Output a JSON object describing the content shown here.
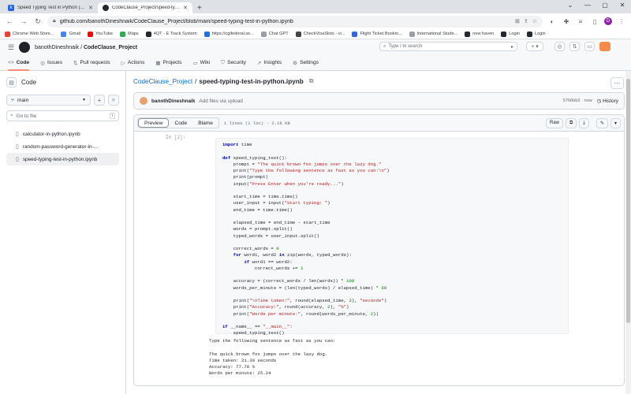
{
  "browser": {
    "tabs": [
      {
        "title": "Speed Typing Test in Python | Ka",
        "active": false,
        "icon": "k"
      },
      {
        "title": "CodeClause_Project/speed-typin",
        "active": true,
        "icon": "github"
      }
    ],
    "url": "github.com/banothDineshnaik/CodeClause_Project/blob/main/speed-typing-test-in-python.ipynb",
    "profile_initial": "D",
    "bookmarks": [
      {
        "label": "Chrome Web Store...",
        "color": "#ea4335"
      },
      {
        "label": "Gmail",
        "color": "#4285f4"
      },
      {
        "label": "YouTube",
        "color": "#ff0000"
      },
      {
        "label": "Maps",
        "color": "#34a853"
      },
      {
        "label": "4QT - E Track System",
        "color": "#24292f"
      },
      {
        "label": "https://cgifederal.se...",
        "color": "#1a73e8"
      },
      {
        "label": "Chat GPT",
        "color": "#9aa0a6"
      },
      {
        "label": "CheckVisaSlots - vi...",
        "color": "#444"
      },
      {
        "label": "Flight Ticket Bookin...",
        "color": "#3367d6"
      },
      {
        "label": "International Stude...",
        "color": "#9aa0a6"
      },
      {
        "label": "new haven",
        "color": "#24292f"
      },
      {
        "label": "Login",
        "color": "#24292f"
      },
      {
        "label": "Login",
        "color": "#24292f"
      }
    ]
  },
  "github": {
    "owner": "banothDineshnaik",
    "repo": "CodeClause_Project",
    "search_placeholder": "Type / to search",
    "nav": [
      {
        "label": "Code",
        "icon": "<>",
        "active": true
      },
      {
        "label": "Issues",
        "icon": "◎",
        "active": false
      },
      {
        "label": "Pull requests",
        "icon": "⇅",
        "active": false
      },
      {
        "label": "Actions",
        "icon": "▷",
        "active": false
      },
      {
        "label": "Projects",
        "icon": "▦",
        "active": false
      },
      {
        "label": "Wiki",
        "icon": "▭",
        "active": false
      },
      {
        "label": "Security",
        "icon": "⛉",
        "active": false
      },
      {
        "label": "Insights",
        "icon": "↗",
        "active": false
      },
      {
        "label": "Settings",
        "icon": "⚙",
        "active": false
      }
    ]
  },
  "sidebar": {
    "title": "Code",
    "branch": "main",
    "goto_placeholder": "Go to file",
    "goto_shortcut": "t",
    "files": [
      {
        "name": "calculator-in-python.ipynb",
        "selected": false
      },
      {
        "name": "random-password-generator-in-...",
        "selected": false
      },
      {
        "name": "speed-typing-test-in-python.ipynb",
        "selected": true
      }
    ]
  },
  "file": {
    "repo_link": "CodeClause_Project",
    "separator": "/",
    "name": "speed-typing-test-in-python.ipynb",
    "commit_author": "banothDineshnaik",
    "commit_message": "Add files via upload",
    "commit_meta": "5766bb2 · now",
    "history_label": "History",
    "tabs": [
      "Preview",
      "Code",
      "Blame"
    ],
    "active_tab": "Preview",
    "meta": "1 lines (1 loc) · 2.18 KB",
    "raw_label": "Raw"
  },
  "notebook": {
    "prompt": "In [2]:",
    "output_lines": [
      "Type the following sentence as fast as you can:",
      "",
      "The quick brown fox jumps over the lazy dog.",
      "Time taken: 21.39 seconds",
      "Accuracy: 77.78 %",
      "Words per minute: 25.24"
    ]
  }
}
